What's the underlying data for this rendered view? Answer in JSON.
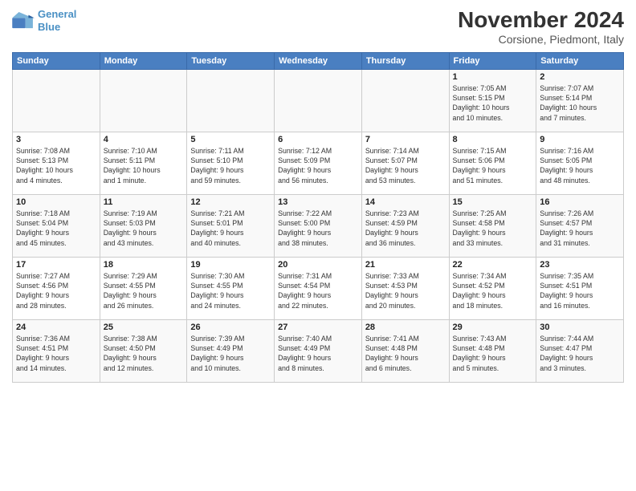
{
  "header": {
    "logo_line1": "General",
    "logo_line2": "Blue",
    "month": "November 2024",
    "location": "Corsione, Piedmont, Italy"
  },
  "weekdays": [
    "Sunday",
    "Monday",
    "Tuesday",
    "Wednesday",
    "Thursday",
    "Friday",
    "Saturday"
  ],
  "weeks": [
    [
      {
        "day": "",
        "info": ""
      },
      {
        "day": "",
        "info": ""
      },
      {
        "day": "",
        "info": ""
      },
      {
        "day": "",
        "info": ""
      },
      {
        "day": "",
        "info": ""
      },
      {
        "day": "1",
        "info": "Sunrise: 7:05 AM\nSunset: 5:15 PM\nDaylight: 10 hours\nand 10 minutes."
      },
      {
        "day": "2",
        "info": "Sunrise: 7:07 AM\nSunset: 5:14 PM\nDaylight: 10 hours\nand 7 minutes."
      }
    ],
    [
      {
        "day": "3",
        "info": "Sunrise: 7:08 AM\nSunset: 5:13 PM\nDaylight: 10 hours\nand 4 minutes."
      },
      {
        "day": "4",
        "info": "Sunrise: 7:10 AM\nSunset: 5:11 PM\nDaylight: 10 hours\nand 1 minute."
      },
      {
        "day": "5",
        "info": "Sunrise: 7:11 AM\nSunset: 5:10 PM\nDaylight: 9 hours\nand 59 minutes."
      },
      {
        "day": "6",
        "info": "Sunrise: 7:12 AM\nSunset: 5:09 PM\nDaylight: 9 hours\nand 56 minutes."
      },
      {
        "day": "7",
        "info": "Sunrise: 7:14 AM\nSunset: 5:07 PM\nDaylight: 9 hours\nand 53 minutes."
      },
      {
        "day": "8",
        "info": "Sunrise: 7:15 AM\nSunset: 5:06 PM\nDaylight: 9 hours\nand 51 minutes."
      },
      {
        "day": "9",
        "info": "Sunrise: 7:16 AM\nSunset: 5:05 PM\nDaylight: 9 hours\nand 48 minutes."
      }
    ],
    [
      {
        "day": "10",
        "info": "Sunrise: 7:18 AM\nSunset: 5:04 PM\nDaylight: 9 hours\nand 45 minutes."
      },
      {
        "day": "11",
        "info": "Sunrise: 7:19 AM\nSunset: 5:03 PM\nDaylight: 9 hours\nand 43 minutes."
      },
      {
        "day": "12",
        "info": "Sunrise: 7:21 AM\nSunset: 5:01 PM\nDaylight: 9 hours\nand 40 minutes."
      },
      {
        "day": "13",
        "info": "Sunrise: 7:22 AM\nSunset: 5:00 PM\nDaylight: 9 hours\nand 38 minutes."
      },
      {
        "day": "14",
        "info": "Sunrise: 7:23 AM\nSunset: 4:59 PM\nDaylight: 9 hours\nand 36 minutes."
      },
      {
        "day": "15",
        "info": "Sunrise: 7:25 AM\nSunset: 4:58 PM\nDaylight: 9 hours\nand 33 minutes."
      },
      {
        "day": "16",
        "info": "Sunrise: 7:26 AM\nSunset: 4:57 PM\nDaylight: 9 hours\nand 31 minutes."
      }
    ],
    [
      {
        "day": "17",
        "info": "Sunrise: 7:27 AM\nSunset: 4:56 PM\nDaylight: 9 hours\nand 28 minutes."
      },
      {
        "day": "18",
        "info": "Sunrise: 7:29 AM\nSunset: 4:55 PM\nDaylight: 9 hours\nand 26 minutes."
      },
      {
        "day": "19",
        "info": "Sunrise: 7:30 AM\nSunset: 4:55 PM\nDaylight: 9 hours\nand 24 minutes."
      },
      {
        "day": "20",
        "info": "Sunrise: 7:31 AM\nSunset: 4:54 PM\nDaylight: 9 hours\nand 22 minutes."
      },
      {
        "day": "21",
        "info": "Sunrise: 7:33 AM\nSunset: 4:53 PM\nDaylight: 9 hours\nand 20 minutes."
      },
      {
        "day": "22",
        "info": "Sunrise: 7:34 AM\nSunset: 4:52 PM\nDaylight: 9 hours\nand 18 minutes."
      },
      {
        "day": "23",
        "info": "Sunrise: 7:35 AM\nSunset: 4:51 PM\nDaylight: 9 hours\nand 16 minutes."
      }
    ],
    [
      {
        "day": "24",
        "info": "Sunrise: 7:36 AM\nSunset: 4:51 PM\nDaylight: 9 hours\nand 14 minutes."
      },
      {
        "day": "25",
        "info": "Sunrise: 7:38 AM\nSunset: 4:50 PM\nDaylight: 9 hours\nand 12 minutes."
      },
      {
        "day": "26",
        "info": "Sunrise: 7:39 AM\nSunset: 4:49 PM\nDaylight: 9 hours\nand 10 minutes."
      },
      {
        "day": "27",
        "info": "Sunrise: 7:40 AM\nSunset: 4:49 PM\nDaylight: 9 hours\nand 8 minutes."
      },
      {
        "day": "28",
        "info": "Sunrise: 7:41 AM\nSunset: 4:48 PM\nDaylight: 9 hours\nand 6 minutes."
      },
      {
        "day": "29",
        "info": "Sunrise: 7:43 AM\nSunset: 4:48 PM\nDaylight: 9 hours\nand 5 minutes."
      },
      {
        "day": "30",
        "info": "Sunrise: 7:44 AM\nSunset: 4:47 PM\nDaylight: 9 hours\nand 3 minutes."
      }
    ]
  ]
}
